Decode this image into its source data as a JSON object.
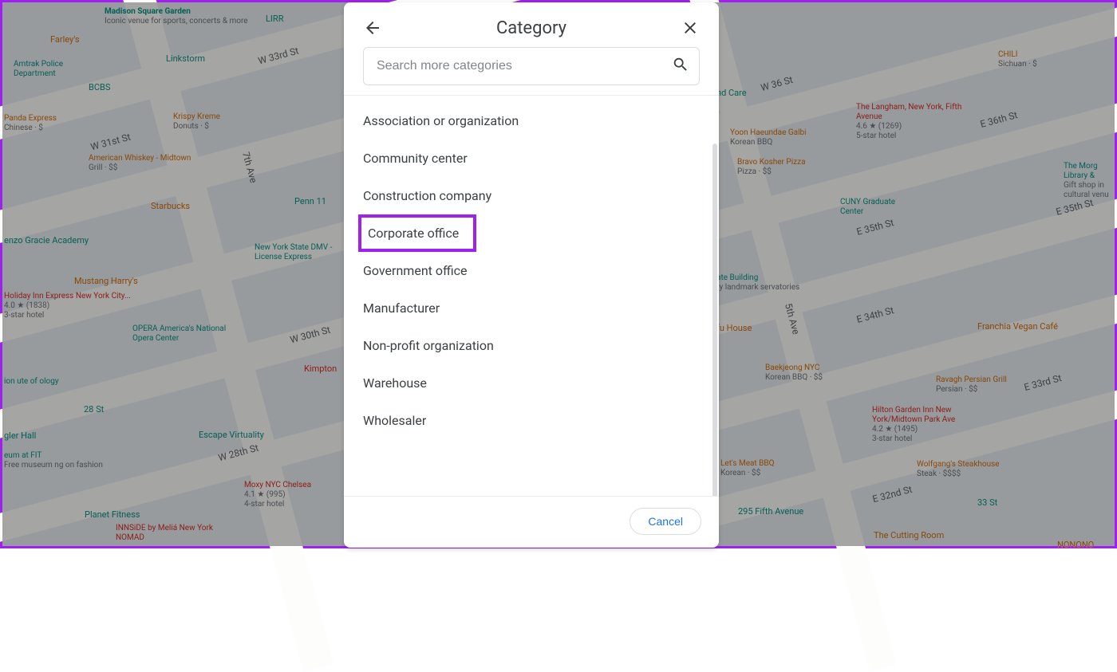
{
  "modal": {
    "title": "Category",
    "search_placeholder": "Search more categories",
    "cancel_label": "Cancel",
    "categories": [
      "Association or organization",
      "Community center",
      "Construction company",
      "Corporate office",
      "Government office",
      "Manufacturer",
      "Non-profit organization",
      "Warehouse",
      "Wholesaler"
    ],
    "highlighted_index": 3
  },
  "map": {
    "streets": [
      "W 33rd St",
      "W 31st St",
      "W 30th St",
      "W 28th St",
      "7th Ave",
      "W 36 St",
      "E 36th St",
      "E 35th St",
      "E 35th St",
      "E 34th St",
      "5th Ave",
      "E 33rd St",
      "E 32nd St"
    ],
    "pois_left": [
      {
        "name": "Madison Square Garden",
        "sub": "Iconic venue for sports, concerts & more",
        "color": "teal"
      },
      {
        "name": "Farley's",
        "color": "orange"
      },
      {
        "name": "Amtrak Police Department",
        "color": "teal"
      },
      {
        "name": "BCBS",
        "color": "teal"
      },
      {
        "name": "Linkstorm",
        "color": "teal"
      },
      {
        "name": "LIRR",
        "color": "teal"
      },
      {
        "name": "Panda Express",
        "sub": "Chinese · $",
        "color": "orange"
      },
      {
        "name": "Krispy Kreme",
        "sub": "Donuts · $",
        "color": "orange"
      },
      {
        "name": "American Whiskey - Midtown",
        "sub": "Grill · $$",
        "color": "orange"
      },
      {
        "name": "Penn 11",
        "color": "teal"
      },
      {
        "name": "Starbucks",
        "color": "orange"
      },
      {
        "name": "enzo Gracie Academy",
        "color": "teal"
      },
      {
        "name": "New York State DMV - License Express",
        "color": "teal"
      },
      {
        "name": "Mustang Harry's",
        "color": "orange"
      },
      {
        "name": "Holiday Inn Express New York City...",
        "rating": "4.0 ★ (1838)",
        "sub": "3-star hotel",
        "color": "red"
      },
      {
        "name": "OPERA America's National Opera Center",
        "color": "teal"
      },
      {
        "name": "Kimpton",
        "color": "red"
      },
      {
        "name": "ion ute of ology",
        "color": "teal"
      },
      {
        "name": "28 St",
        "color": "teal"
      },
      {
        "name": "Escape Virtuality",
        "color": "teal"
      },
      {
        "name": "eum at FIT",
        "sub": "Free museum ng on fashion",
        "color": "teal"
      },
      {
        "name": "gler Hall",
        "color": "teal"
      },
      {
        "name": "Planet Fitness",
        "color": "teal"
      },
      {
        "name": "Moxy NYC Chelsea",
        "rating": "4.1 ★ (995)",
        "sub": "4-star hotel",
        "color": "red"
      },
      {
        "name": "INNSiDE by Meliá New York NOMAD",
        "color": "red"
      }
    ],
    "pois_right": [
      {
        "name": "CHILI",
        "sub": "Sichuan · $",
        "color": "orange"
      },
      {
        "name": "The Langham, New York, Fifth Avenue",
        "rating": "4.6 ★ (1269)",
        "sub": "5-star hotel",
        "color": "red"
      },
      {
        "name": "Yoon Haeundae Galbi",
        "sub": "Korean BBQ",
        "color": "orange"
      },
      {
        "name": "Bravo Kosher Pizza",
        "sub": "Pizza · $$",
        "color": "orange"
      },
      {
        "name": "nd Care",
        "color": "teal"
      },
      {
        "name": "CUNY Graduate Center",
        "color": "teal"
      },
      {
        "name": "The Morg Library &",
        "sub": "Gift shop in cultural venu",
        "color": "teal"
      },
      {
        "name": "ate Building",
        "sub": "ry landmark servatories",
        "color": "teal"
      },
      {
        "name": "fu House",
        "color": "orange"
      },
      {
        "name": "Franchia Vegan Café",
        "color": "orange"
      },
      {
        "name": "Baekjeong NYC",
        "sub": "Korean BBQ · $$",
        "color": "orange"
      },
      {
        "name": "Ravagh Persian Grill",
        "sub": "Persian · $$",
        "color": "orange"
      },
      {
        "name": "Hilton Garden Inn New York/Midtown Park Ave",
        "rating": "4.2 ★ (1495)",
        "sub": "3-star hotel",
        "color": "red"
      },
      {
        "name": "Let's Meat BBQ",
        "sub": "Korean · $$",
        "color": "orange"
      },
      {
        "name": "Wolfgang's Steakhouse",
        "sub": "Steak · $$$$",
        "color": "orange"
      },
      {
        "name": "295 Fifth Avenue",
        "color": "teal"
      },
      {
        "name": "33 St",
        "color": "teal"
      },
      {
        "name": "The Cutting Room",
        "color": "orange"
      },
      {
        "name": "NONONO",
        "color": "orange"
      }
    ]
  }
}
